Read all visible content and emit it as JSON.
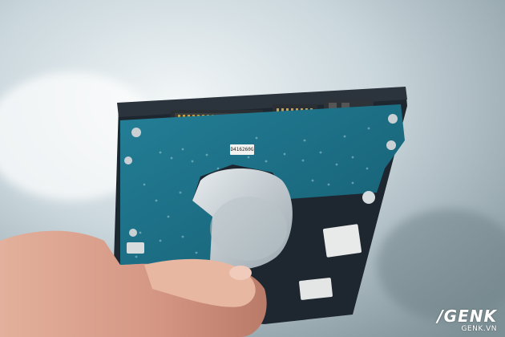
{
  "photo": {
    "subject": "Back of a 2.5-inch hard disk drive held in a hand",
    "pcb_label_text": "D416260G",
    "colors": {
      "pcb": "#1a6f86",
      "drive_body": "#1e2630",
      "background": "#a9b8c0",
      "skin": "#d59a84"
    }
  },
  "watermark": {
    "logo": "/GENK",
    "url": "GENK.VN"
  }
}
